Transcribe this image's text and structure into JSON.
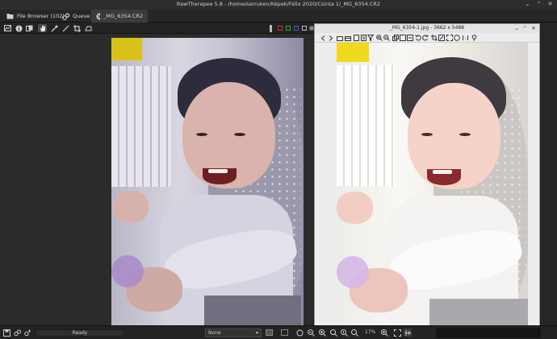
{
  "window": {
    "title": "RawTherapee 5.8 - /home/sarruken/Képek/Félix 2020/Csinta 1/_MG_6354.CR2",
    "minimize": "⌄",
    "maximize": "⌃",
    "close": "✕"
  },
  "tabs": [
    {
      "label": "File Browser (102)",
      "icon": "folder-icon",
      "active": false
    },
    {
      "label": "Queue",
      "icon": "gears-icon",
      "active": false
    },
    {
      "label": "_MG_6354.CR2",
      "icon": "close-icon",
      "active": true
    }
  ],
  "toolbar": {
    "tools": [
      "histogram-icon",
      "info-icon",
      "before-after-icon",
      "hand-icon",
      "color-picker-icon",
      "straighten-icon",
      "crop-icon",
      "perspective-icon"
    ]
  },
  "viewer": {
    "title": "_MG_6354-1.jpg - 3662 x 5488",
    "controls": [
      "⌄",
      "⌃",
      "✕"
    ],
    "tools": [
      "back-icon",
      "forward-icon",
      "folder-icon",
      "folder-open-icon",
      "document-icon",
      "document-icon",
      "filter-icon",
      "zoom-in-icon",
      "zoom-out-icon",
      "copy-icon",
      "copy-icon",
      "copy-icon",
      "undo-icon",
      "redo-icon",
      "crop-icon",
      "resize-icon",
      "fullscreen-icon",
      "fit-icon",
      "one-to-one-icon",
      "pin-icon"
    ]
  },
  "bottom": {
    "status": "Ready",
    "preview_mode": "None",
    "zoom_level": "17%",
    "progress_fraction": 0.0
  },
  "colors": {
    "app_bg": "#1f1f1f",
    "panel_bg": "#2b2b2b",
    "viewer_bg": "#ededed",
    "accent_yellow": "#d8c21a"
  }
}
